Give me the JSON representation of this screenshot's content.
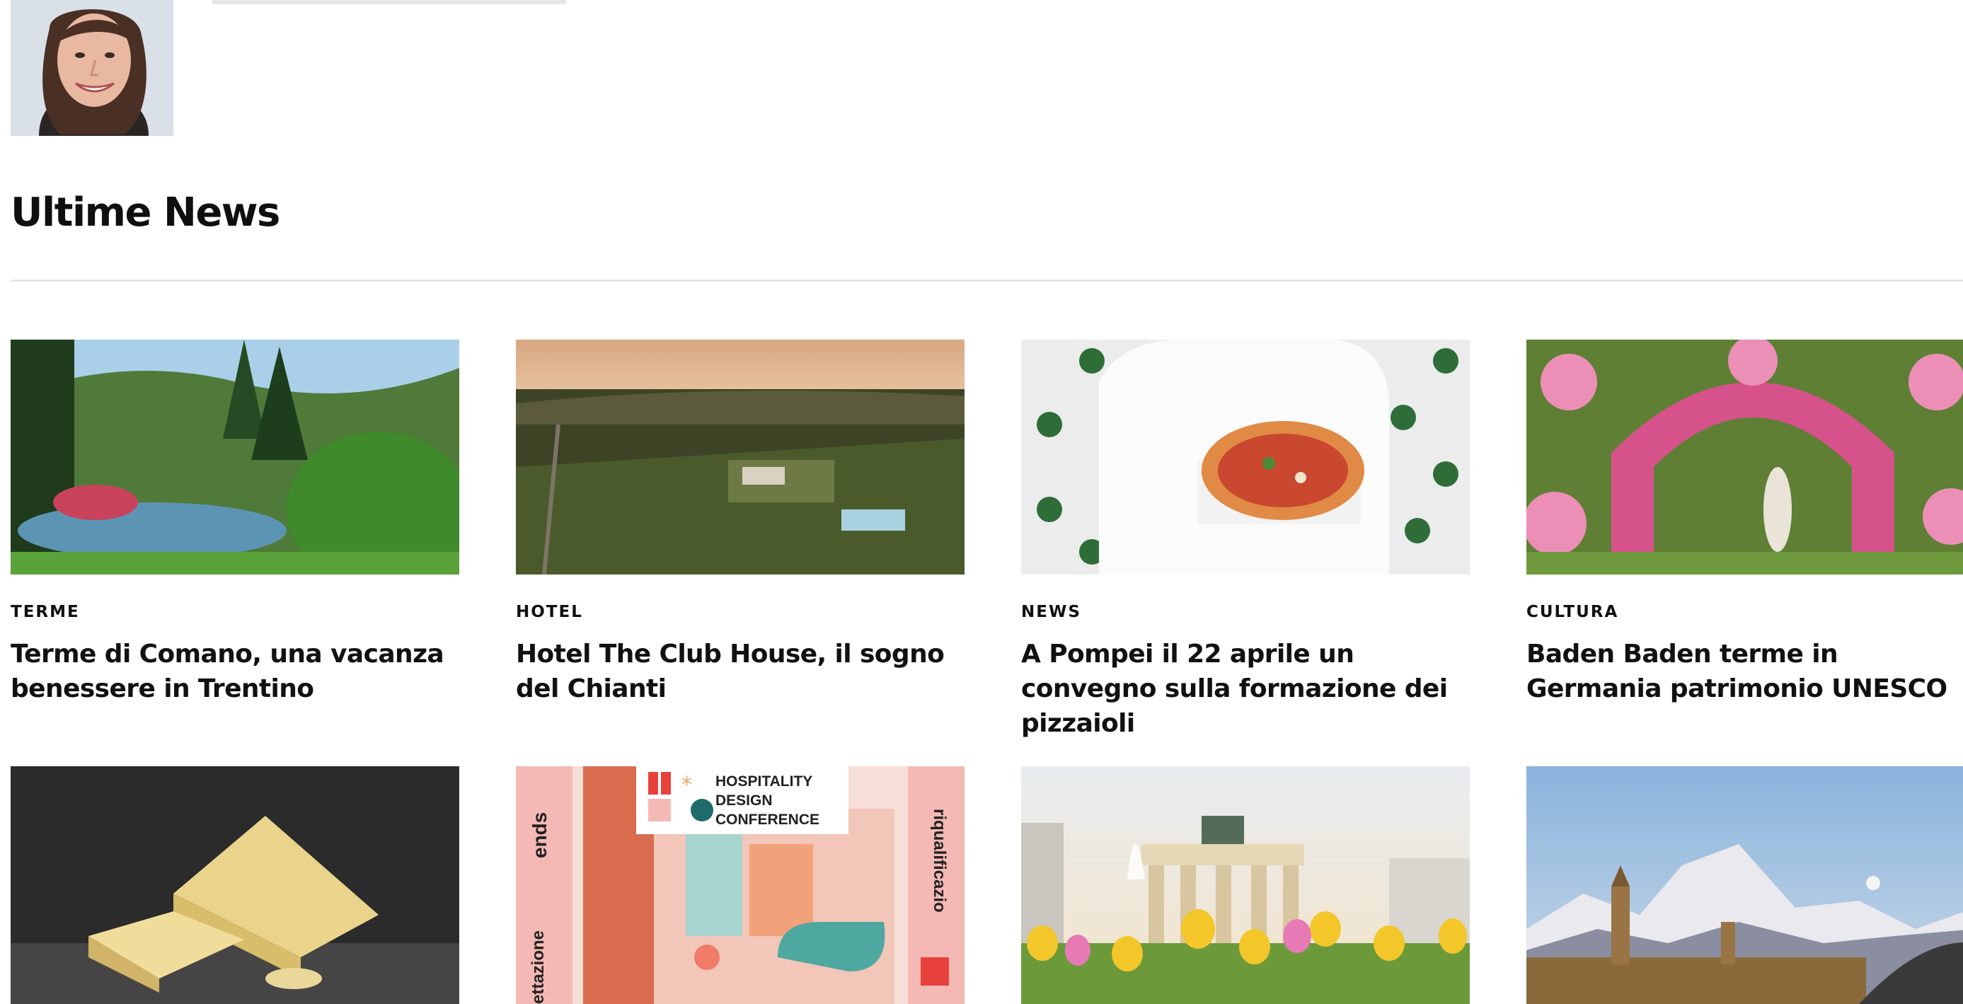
{
  "section": {
    "title": "Ultime News"
  },
  "articles": [
    {
      "category": "TERME",
      "title": "Terme di Comano, una vacanza benessere in Trentino",
      "image": "park-lake-image"
    },
    {
      "category": "HOTEL",
      "title": "Hotel The Club House, il sogno del Chianti",
      "image": "chianti-aerial-image"
    },
    {
      "category": "NEWS",
      "title": "A Pompei il 22 aprile un convegno sulla formazione dei pizzaioli",
      "image": "pizza-chef-image"
    },
    {
      "category": "CULTURA",
      "title": "Baden Baden terme in Germania patrimonio UNESCO",
      "image": "rose-garden-image"
    }
  ],
  "second_row": [
    {
      "image": "cheese-image"
    },
    {
      "image": "hospitality-design-poster",
      "poster": {
        "line1": "HOSPITALITY",
        "line2": "DESIGN",
        "line3": "CONFERENCE",
        "left_text": "ends",
        "left_text_2": "ettazione",
        "right_text": "riqualificazio"
      }
    },
    {
      "image": "brandenburg-gate-image"
    },
    {
      "image": "mountain-town-image"
    }
  ],
  "colors": {
    "text": "#111111",
    "divider": "#e6e6e6",
    "poster_pink": "#f4b9b4",
    "poster_red": "#e8413c"
  }
}
